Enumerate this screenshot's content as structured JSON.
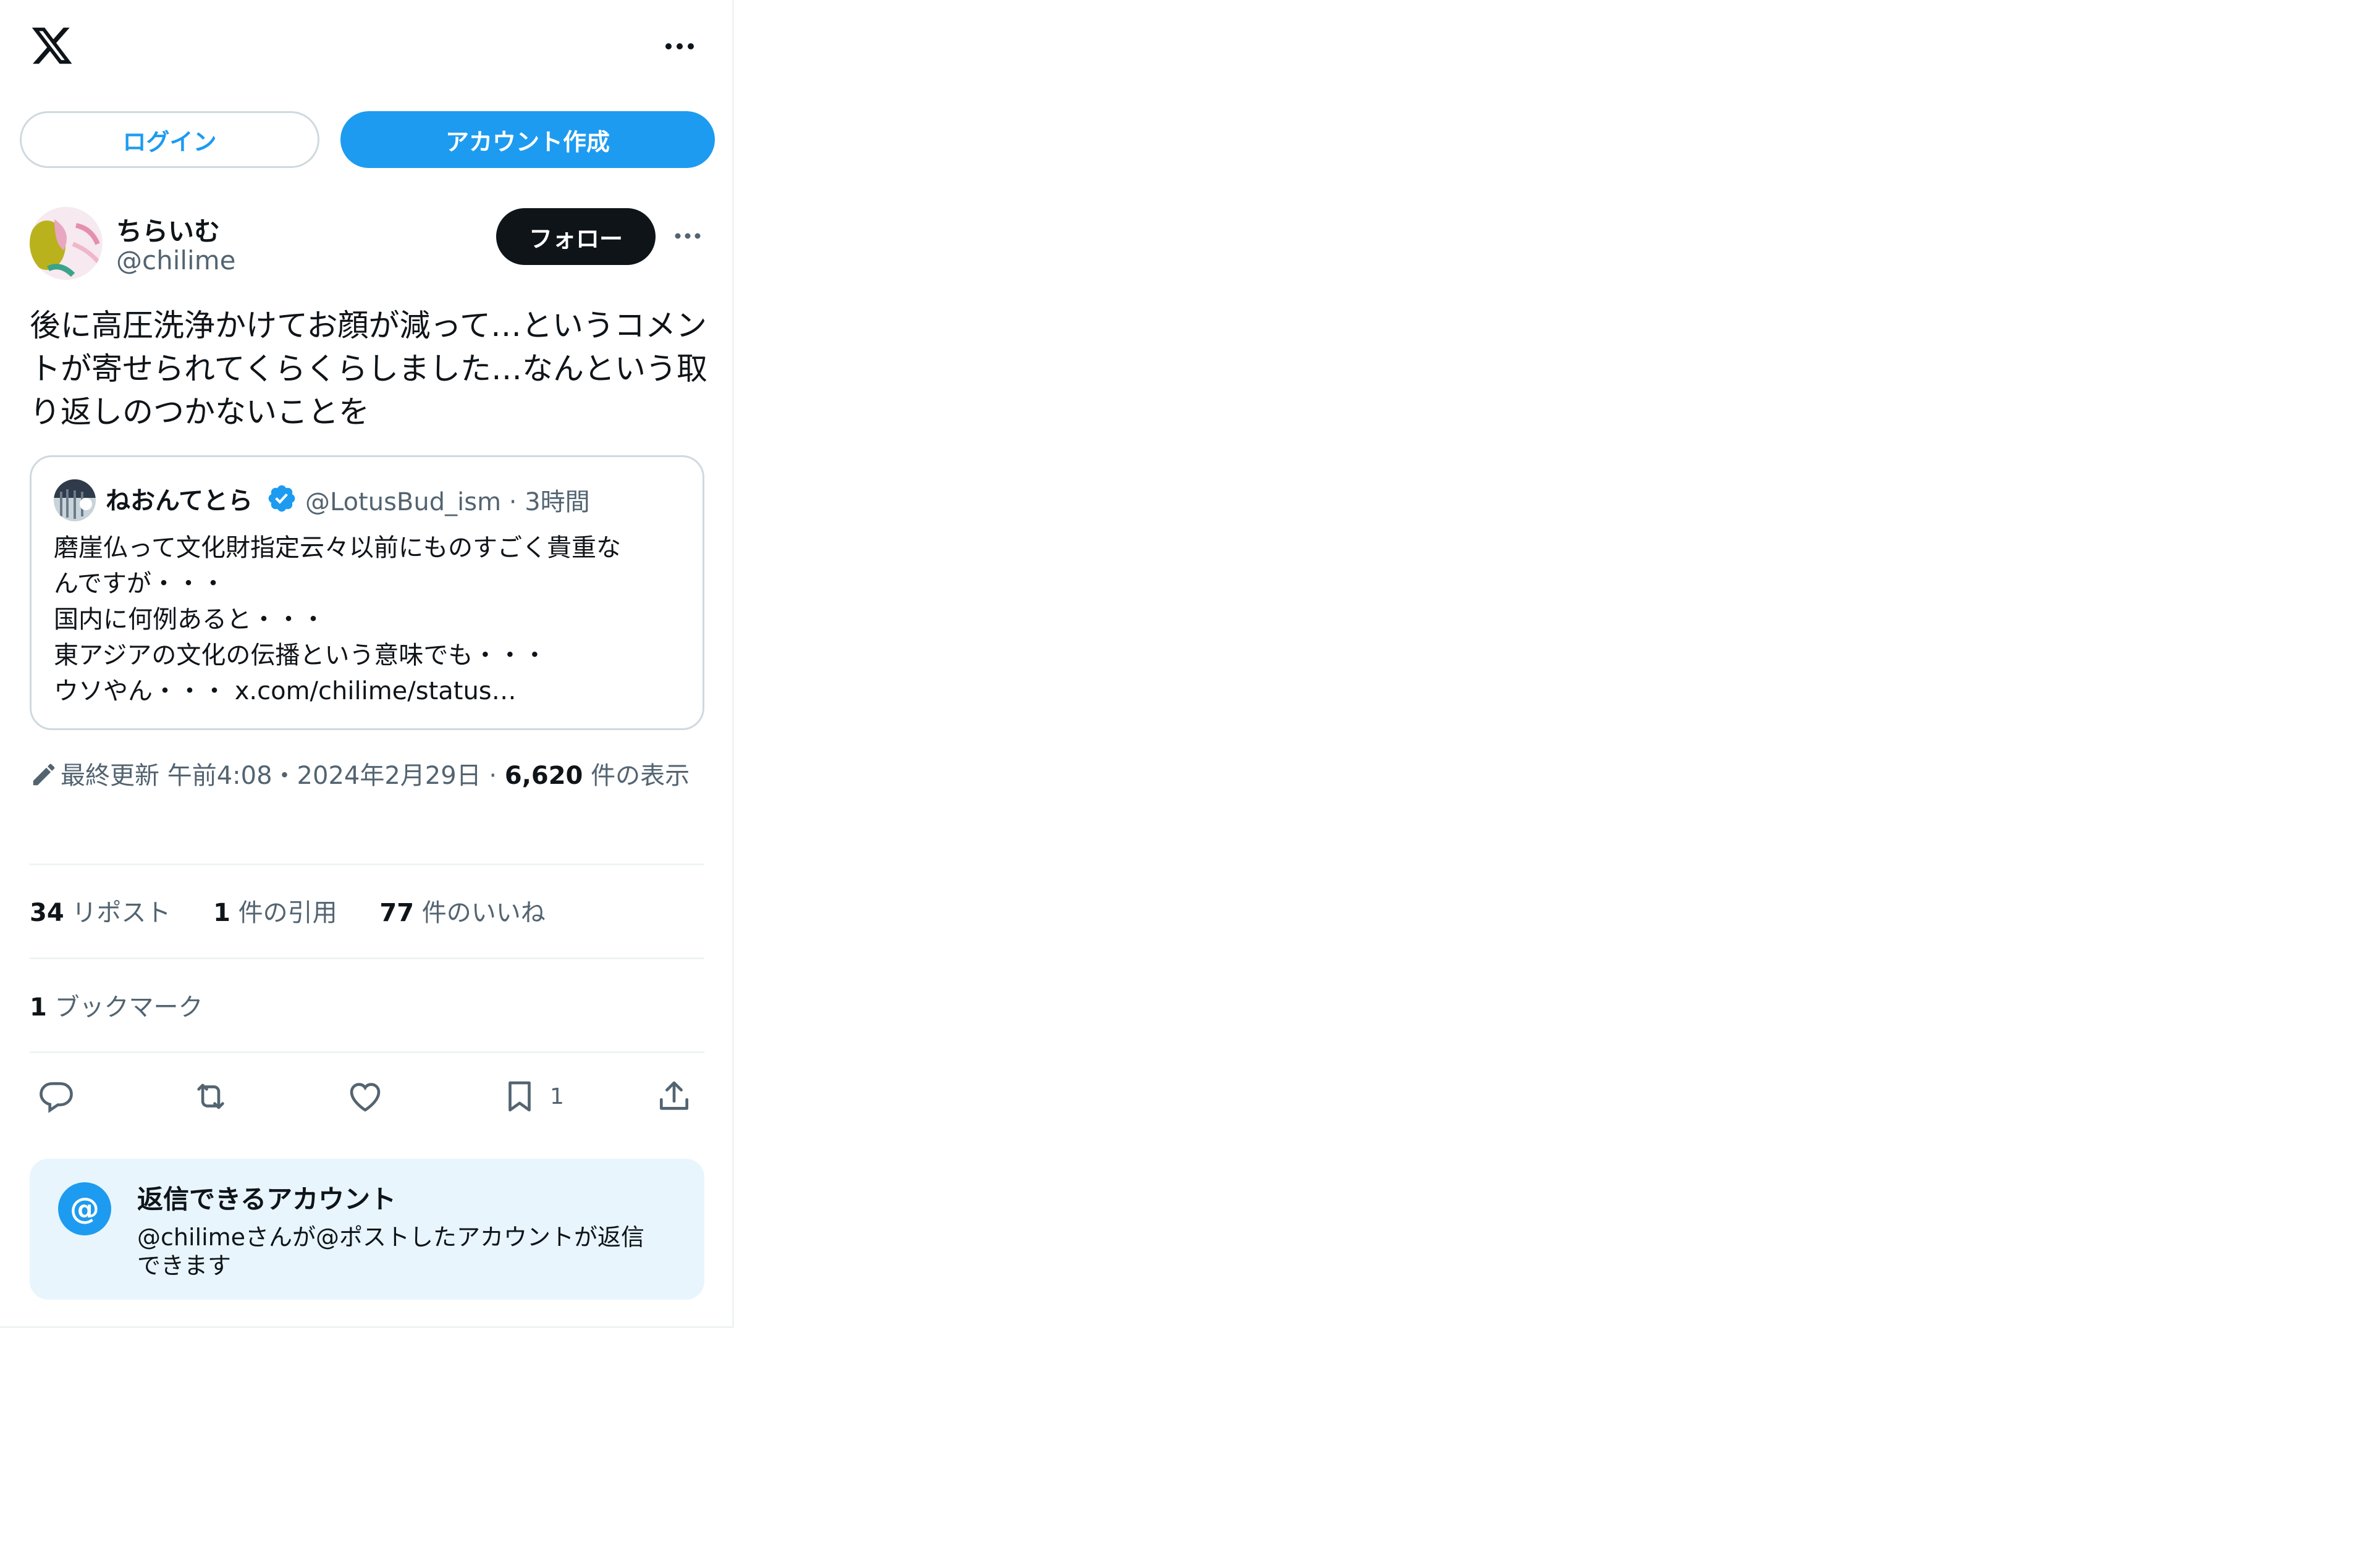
{
  "header": {
    "logo": "x-logo",
    "more_icon": "more-horizontal-icon"
  },
  "auth": {
    "login_label": "ログイン",
    "signup_label": "アカウント作成"
  },
  "post": {
    "author_name": "ちらいむ",
    "author_handle": "@chilime",
    "follow_label": "フォロー",
    "text": "後に高圧洗浄かけてお顔が減って…というコメン\nトが寄せられてくらくらしました…なんという取\nり返しのつかないことを",
    "quote": {
      "author_name": "ねおんてとら",
      "author_handle": "@LotusBud_ism",
      "separator": "·",
      "time": "3時間",
      "text": "磨崖仏って文化財指定云々以前にものすごく貴重な\nんですが・・・\n国内に何例あると・・・\n東アジアの文化の伝播という意味でも・・・\nウソやん・・・ x.com/chilime/status…"
    },
    "meta": {
      "edited_label": "最終更新",
      "time": "午前4:08",
      "date": "2024年2月29日",
      "dot": "·",
      "views_count": "6,620",
      "views_label": "件の表示"
    },
    "stats": {
      "reposts_count": "34",
      "reposts_label": "リポスト",
      "quotes_count": "1",
      "quotes_label": "件の引用",
      "likes_count": "77",
      "likes_label": "件のいいね"
    },
    "bookmarks": {
      "count": "1",
      "label": "ブックマーク"
    },
    "actions": {
      "reply_icon": "reply-icon",
      "repost_icon": "repost-icon",
      "like_icon": "heart-icon",
      "bookmark_icon": "bookmark-icon",
      "bookmark_count": "1",
      "share_icon": "share-icon"
    }
  },
  "reply_restriction": {
    "icon_glyph": "@",
    "title": "返信できるアカウント",
    "description": "@chilimeさんが@ポストしたアカウントが返信\nできます"
  },
  "colors": {
    "accent": "#1d9bf0",
    "text": "#0f1419",
    "muted": "#536471",
    "border": "#cfd9de",
    "divider": "#eff3f4",
    "reply_bg": "#e8f5fd"
  }
}
